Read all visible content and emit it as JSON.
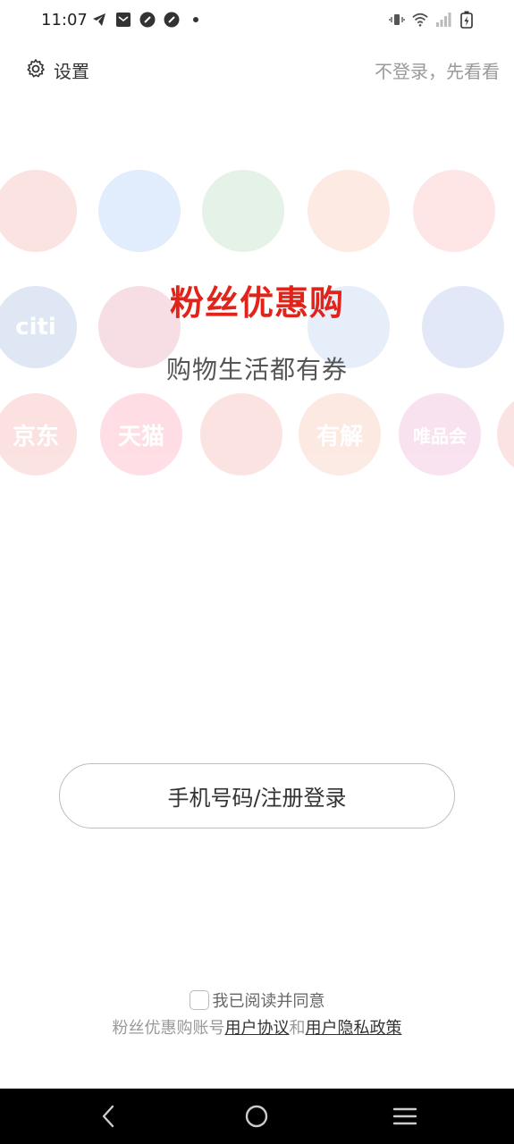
{
  "status_bar": {
    "time": "11:07",
    "left_icons": [
      "telegram-icon",
      "mail-icon",
      "app-icon",
      "app-icon",
      "dot-icon"
    ],
    "right_icons": [
      "vibrate-icon",
      "wifi-icon",
      "signal-icon",
      "battery-charging-icon"
    ]
  },
  "top_bar": {
    "settings_label": "设置",
    "skip_label": "不登录，先看看"
  },
  "background_logos": [
    {
      "label": "",
      "color": "#e2231a"
    },
    {
      "label": "",
      "color": "#1a73e8"
    },
    {
      "label": "",
      "color": "#2e9e4f"
    },
    {
      "label": "",
      "color": "#f15a24"
    },
    {
      "label": "",
      "color": "#ff3d3d"
    },
    {
      "label": "citi",
      "color": "#0a4fa8"
    },
    {
      "label": "",
      "color": "#c4002e"
    },
    {
      "label": "",
      "color": "#3a7bd5"
    },
    {
      "label": "",
      "color": "#1f4fc8"
    },
    {
      "label": "京东",
      "color": "#e2231a"
    },
    {
      "label": "天猫",
      "color": "#ff0036"
    },
    {
      "label": "",
      "color": "#e2231a"
    },
    {
      "label": "有解",
      "color": "#e85f2b"
    },
    {
      "label": "唯品会",
      "color": "#d9288f"
    },
    {
      "label": "",
      "color": "#e2231a"
    }
  ],
  "hero": {
    "title": "粉丝优惠购",
    "slogan": "购物生活都有券"
  },
  "login": {
    "button_label": "手机号码/注册登录"
  },
  "agreement": {
    "checkbox_label": "我已阅读并同意",
    "prefix": "粉丝优惠购账号",
    "user_agreement": "用户协议",
    "conjunction": "和",
    "privacy_policy": "用户隐私政策"
  },
  "nav_bar": {
    "icons": [
      "back-icon",
      "home-icon",
      "menu-icon"
    ]
  },
  "colors": {
    "brand_red": "#e2231a",
    "muted_text": "#9a9a9a",
    "nav_bg": "#000000"
  }
}
